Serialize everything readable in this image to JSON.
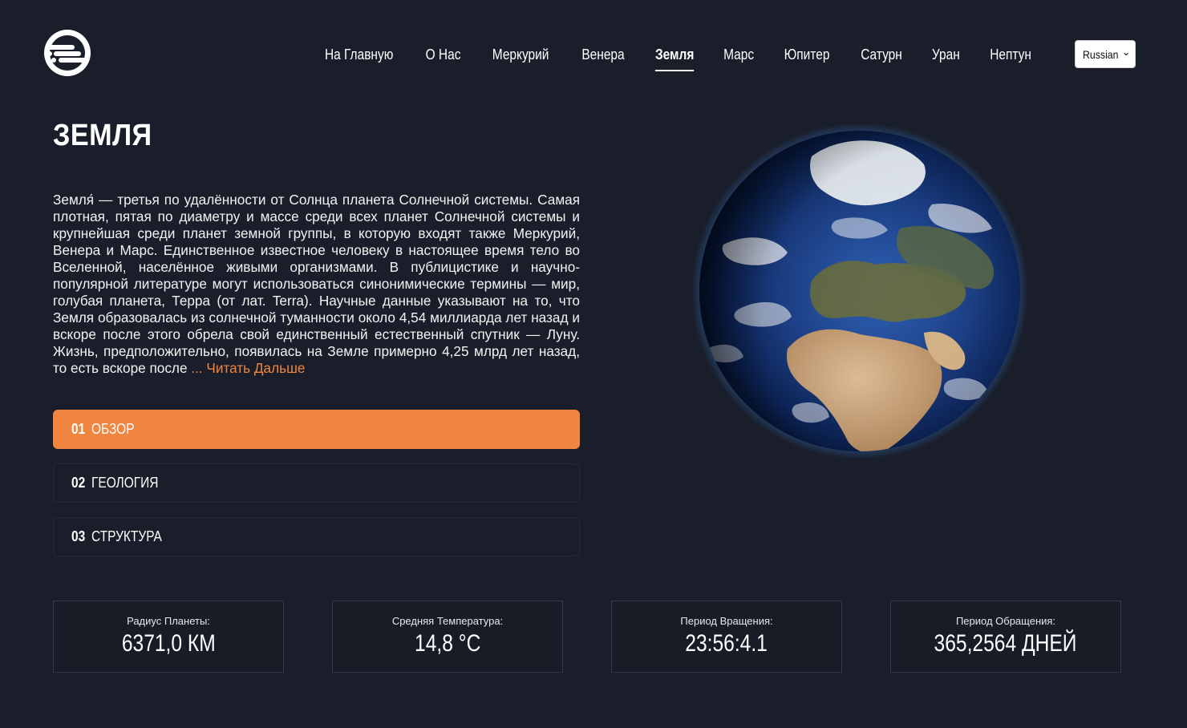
{
  "nav": {
    "items": [
      {
        "label": "На Главную",
        "active": false
      },
      {
        "label": "О Нас",
        "active": false
      },
      {
        "label": "Меркурий",
        "active": false
      },
      {
        "label": "Венера",
        "active": false
      },
      {
        "label": "Земля",
        "active": true
      },
      {
        "label": "Марс",
        "active": false
      },
      {
        "label": "Юпитер",
        "active": false
      },
      {
        "label": "Сатурн",
        "active": false
      },
      {
        "label": "Уран",
        "active": false
      },
      {
        "label": "Нептун",
        "active": false
      }
    ],
    "language": {
      "selected": "Russian"
    }
  },
  "planet": {
    "title": "ЗЕМЛЯ",
    "description": "Земля́ — третья по удалённости от Солнца планета Солнечной системы. Самая плотная, пятая по диаметру и массе среди всех планет Солнечной системы и крупнейшая среди планет земной группы, в которую входят также Меркурий, Венера и Марс. Единственное известное человеку в настоящее время тело во Вселенной, населённое живыми организмами. В публицистике и научно-популярной литературе могут использоваться синонимические термины — мир, голубая планета, Терра (от лат. Terra). Научные данные указывают на то, что Земля образовалась из солнечной туманности около 4,54 миллиарда лет назад и вскоре после этого обрела свой единственный естественный спутник — Луну. Жизнь, предположительно, появилась на Земле примерно 4,25 млрд лет назад, то есть вскоре после ",
    "read_more": "... Читать Дальше"
  },
  "tabs": [
    {
      "num": "01",
      "label": "ОБЗОР",
      "active": true
    },
    {
      "num": "02",
      "label": "ГЕОЛОГИЯ",
      "active": false
    },
    {
      "num": "03",
      "label": "СТРУКТУРА",
      "active": false
    }
  ],
  "stats": [
    {
      "label": "Радиус Планеты:",
      "value": "6371,0 КМ"
    },
    {
      "label": "Средняя Температура:",
      "value": "14,8 °C"
    },
    {
      "label": "Период Вращения:",
      "value": "23:56:4.1"
    },
    {
      "label": "Период Обращения:",
      "value": "365,2564 ДНЕЙ"
    }
  ],
  "colors": {
    "background": "#191e2a",
    "accent": "#f0853f",
    "text": "#ffffff"
  },
  "icons": {
    "logo": "planet-logo-icon",
    "language_dropdown": "chevron-down-icon"
  }
}
